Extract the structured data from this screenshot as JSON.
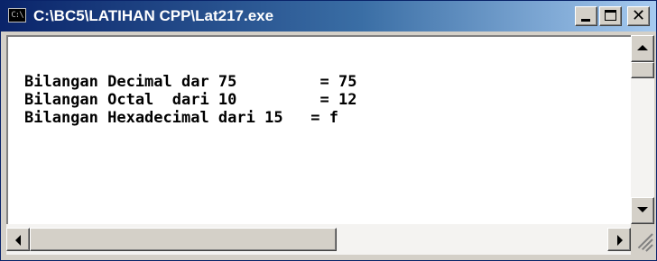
{
  "window": {
    "title": "C:\\BC5\\LATIHAN CPP\\Lat217.exe",
    "system_icon_text": "C:\\",
    "icons": {
      "system": "console-window-icon",
      "minimize": "minimize-icon",
      "maximize": "maximize-icon",
      "close": "close-icon"
    },
    "colors": {
      "title_bar_start": "#0a246a",
      "title_bar_end": "#a6caf0",
      "console_background": "#ffffff",
      "console_text": "#000000",
      "chrome": "#d4d0c8"
    }
  },
  "console": {
    "lines": [
      "Bilangan Decimal dar 75         = 75",
      "Bilangan Octal  dari 10         = 12",
      "Bilangan Hexadecimal dari 15   = f"
    ]
  },
  "scrollbars": {
    "icons": {
      "up": "up-arrow-icon",
      "down": "down-arrow-icon",
      "left": "left-arrow-icon",
      "right": "right-arrow-icon",
      "grip": "resize-grip-icon"
    }
  }
}
